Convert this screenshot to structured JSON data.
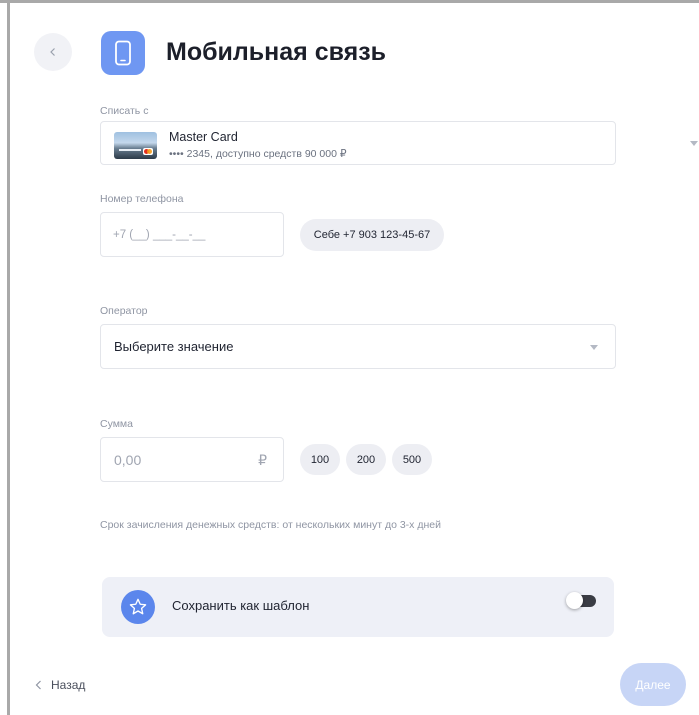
{
  "header": {
    "title": "Мобильная связь",
    "back_icon": "chevron-left-icon",
    "title_icon": "smartphone-icon"
  },
  "debit_from": {
    "label": "Списать с",
    "card_name": "Master Card",
    "card_details": "•••• 2345, доступно средств 90 000 ₽"
  },
  "phone": {
    "label": "Номер телефона",
    "placeholder": "+7 (__) ___-__-__",
    "self_chip": "Себе +7 903 123-45-67"
  },
  "operator": {
    "label": "Оператор",
    "placeholder": "Выберите значение"
  },
  "amount": {
    "label": "Сумма",
    "placeholder": "0,00",
    "currency": "₽",
    "presets": [
      "100",
      "200",
      "500"
    ]
  },
  "note": "Срок зачисления денежных средств: от нескольких минут до 3-х дней",
  "template": {
    "label": "Сохранить как шаблон",
    "enabled": false
  },
  "footer": {
    "back_label": "Назад",
    "next_label": "Далее"
  },
  "colors": {
    "accent": "#5b86ec",
    "next_disabled": "#c7d5f6",
    "template_bg": "#eef0f7"
  }
}
